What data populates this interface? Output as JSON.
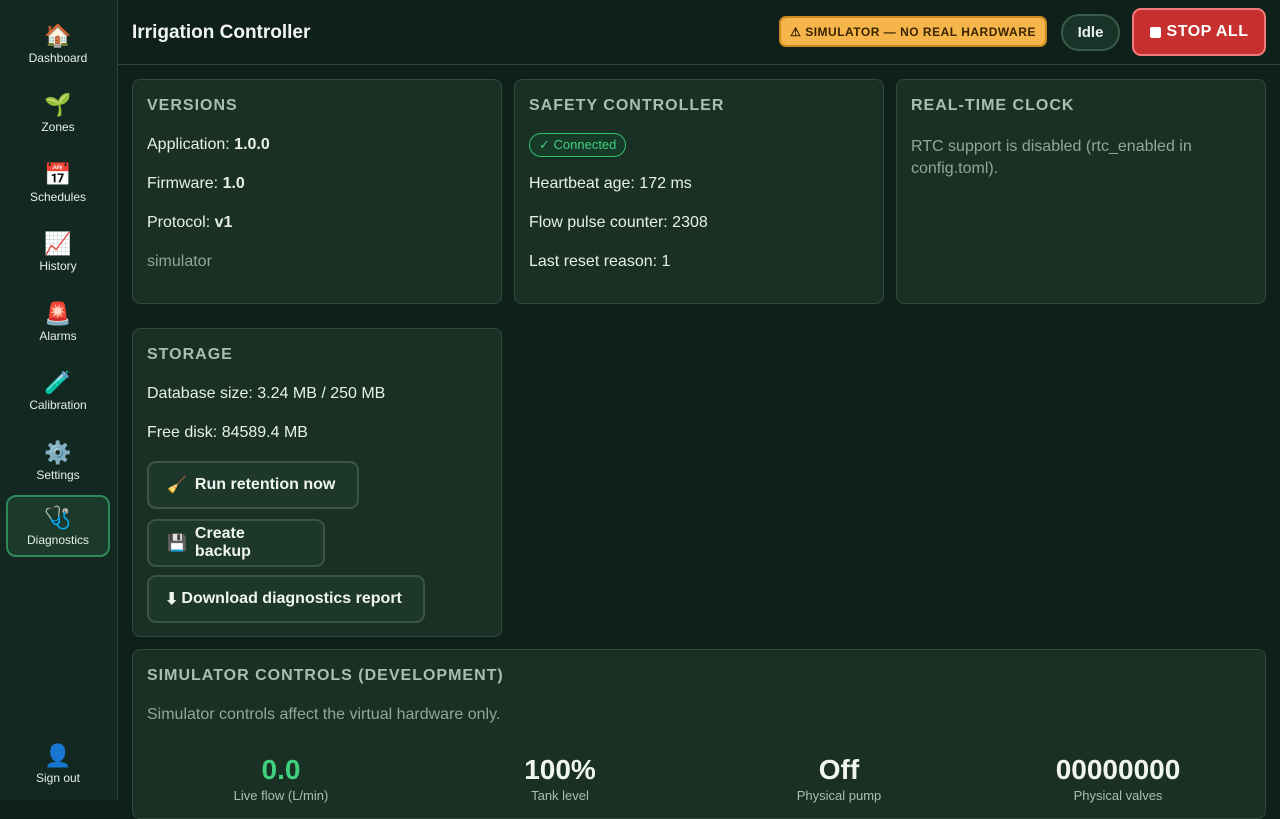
{
  "sidebar": {
    "items": [
      {
        "label": "Dashboard",
        "icon": "🏠"
      },
      {
        "label": "Zones",
        "icon": "🌱"
      },
      {
        "label": "Schedules",
        "icon": "📅"
      },
      {
        "label": "History",
        "icon": "📈"
      },
      {
        "label": "Alarms",
        "icon": "🚨"
      },
      {
        "label": "Calibration",
        "icon": "🧪"
      },
      {
        "label": "Settings",
        "icon": "⚙️"
      },
      {
        "label": "Diagnostics",
        "icon": "🩺"
      }
    ],
    "signout": {
      "label": "Sign out",
      "icon": "👤"
    }
  },
  "header": {
    "title": "Irrigation Controller",
    "sim_badge": "⚠ SIMULATOR — NO REAL HARDWARE",
    "status": "Idle",
    "stop_label": "STOP ALL"
  },
  "versions": {
    "title": "VERSIONS",
    "application_label": "Application: ",
    "application": "1.0.0",
    "firmware_label": "Firmware: ",
    "firmware": "1.0",
    "protocol_label": "Protocol: ",
    "protocol": "v1",
    "mode": "simulator"
  },
  "safety": {
    "title": "SAFETY CONTROLLER",
    "status": "✓ Connected",
    "heartbeat": "Heartbeat age: 172 ms",
    "flow": "Flow pulse counter: 2308",
    "reset": "Last reset reason: 1"
  },
  "rtc": {
    "title": "REAL-TIME CLOCK",
    "message": "RTC support is disabled (rtc_enabled in config.toml)."
  },
  "storage": {
    "title": "STORAGE",
    "db_size": "Database size: 3.24 MB / 250 MB",
    "free_disk": "Free disk: 84589.4 MB",
    "retention_label": "Run retention now",
    "retention_icon": "🧹",
    "backup_label": "Create backup",
    "backup_icon": "💾",
    "report_label": "Download diagnostics report",
    "report_icon": "⬇"
  },
  "simulator": {
    "title": "SIMULATOR CONTROLS (DEVELOPMENT)",
    "note": "Simulator controls affect the virtual hardware only.",
    "stats": [
      {
        "value": "0.0",
        "label": "Live flow (L/min)"
      },
      {
        "value": "100%",
        "label": "Tank level"
      },
      {
        "value": "Off",
        "label": "Physical pump"
      },
      {
        "value": "00000000",
        "label": "Physical valves"
      }
    ]
  },
  "colors": {
    "accent": "#3fd07e",
    "danger": "#c8302f",
    "warning": "#f5b54a"
  }
}
